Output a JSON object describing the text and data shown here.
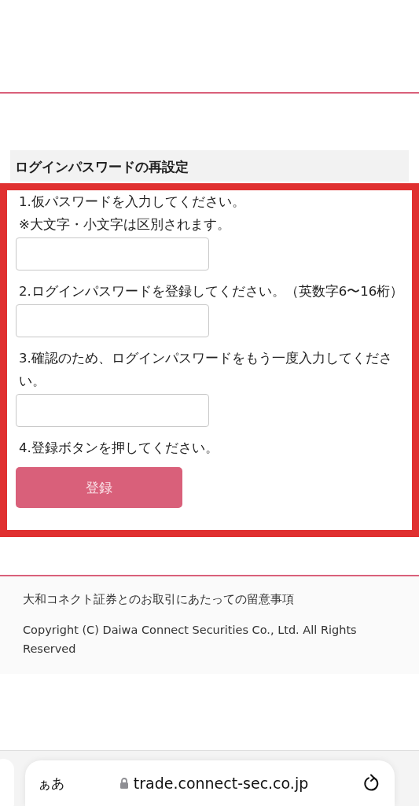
{
  "section_title": "ログインパスワードの再設定",
  "steps": [
    {
      "kind": "field",
      "lines": [
        "1.仮パスワードを入力してください。",
        "※大文字・小文字は区別されます。"
      ]
    },
    {
      "kind": "field",
      "lines": [
        "2.ログインパスワードを登録してください。（英数字6〜16桁）"
      ]
    },
    {
      "kind": "field",
      "lines": [
        "3.確認のため、ログインパスワードをもう一度入力してください。"
      ]
    },
    {
      "kind": "button",
      "lines": [
        "4.登録ボタンを押してください。"
      ],
      "button": "登録"
    }
  ],
  "footer": {
    "link": "大和コネクト証券とのお取引にあたっての留意事項",
    "copyright": "Copyright (C) Daiwa Connect Securities Co., Ltd. All Rights Reserved"
  },
  "browser_bar": {
    "text_size": "ぁあ",
    "url": "trade.connect-sec.co.jp"
  }
}
